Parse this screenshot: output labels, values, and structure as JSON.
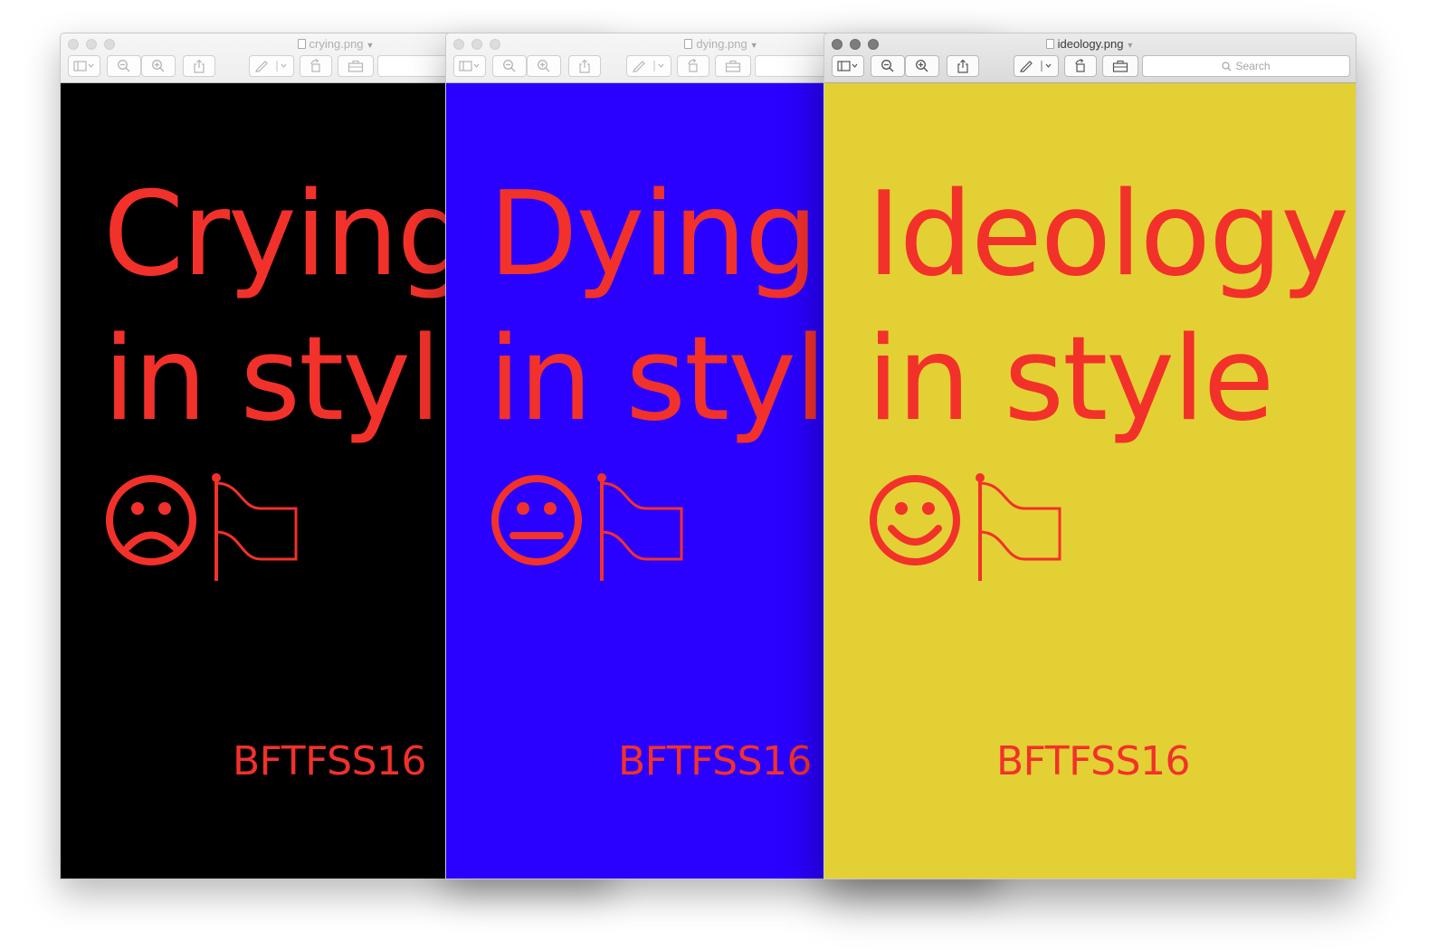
{
  "accent_color": "#f2312a",
  "windows": [
    {
      "filename": "crying.png",
      "background": "#000000",
      "headline_line1": "Crying",
      "headline_line2": "in style",
      "face_icon": "sad-face-icon",
      "flag_icon": "flag-icon",
      "tag": "BFTFSS16",
      "search_placeholder": ""
    },
    {
      "filename": "dying.png",
      "background": "#2a00ff",
      "headline_line1": "Dying",
      "headline_line2": "in style",
      "face_icon": "neutral-face-icon",
      "flag_icon": "flag-icon",
      "tag": "BFTFSS16",
      "search_placeholder": ""
    },
    {
      "filename": "ideology.png",
      "background": "#e3d034",
      "headline_line1": "Ideology",
      "headline_line2": "in style",
      "face_icon": "smiley-face-icon",
      "flag_icon": "flag-icon",
      "tag": "BFTFSS16",
      "search_placeholder": "Search"
    }
  ]
}
